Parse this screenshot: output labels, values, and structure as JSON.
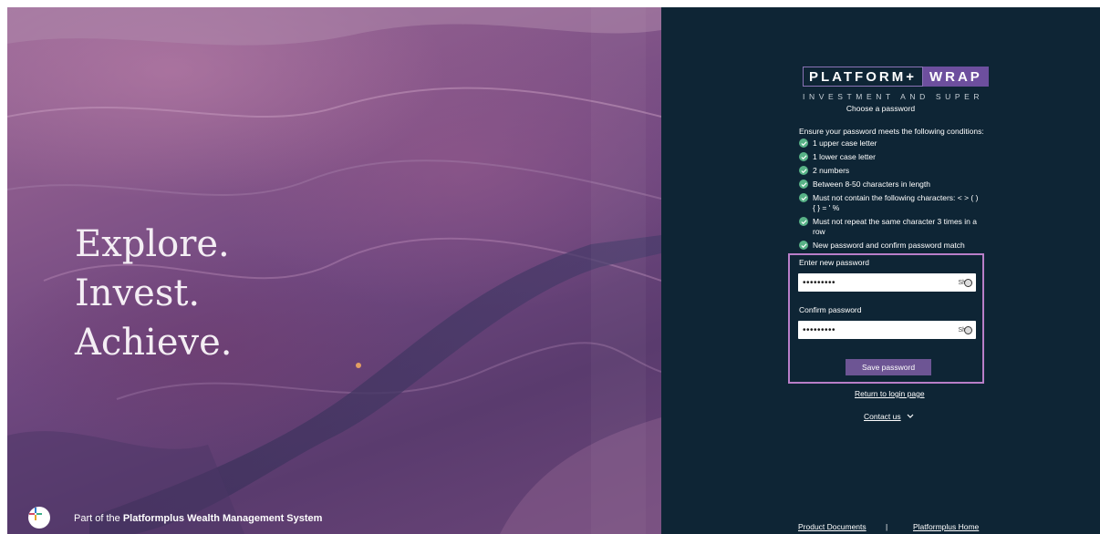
{
  "hero": {
    "lines": [
      "Explore.",
      "Invest.",
      "Achieve."
    ],
    "footer_prefix": "Part of the ",
    "footer_bold": "Platformplus Wealth Management System"
  },
  "logo": {
    "left": "PLATFORM+",
    "right": "WRAP",
    "subtitle": "INVESTMENT AND SUPER"
  },
  "form": {
    "heading": "Choose a password",
    "conditions_intro": "Ensure your password meets the following conditions:",
    "conditions": [
      "1 upper case letter",
      "1 lower case letter",
      "2 numbers",
      "Between 8-50 characters in length",
      "Must not contain the following characters: < > ( ) { } = ' %",
      "Must not repeat the same character 3 times in a row",
      "New password and confirm password match"
    ],
    "new_password_label": "Enter new password",
    "new_password_value": "•••••••••",
    "confirm_password_label": "Confirm password",
    "confirm_password_value": "•••••••••",
    "show_label": "Sh",
    "save_label": "Save password",
    "return_link": "Return to login page",
    "contact_label": "Contact us"
  },
  "footer": {
    "product_docs": "Product Documents",
    "separator": "|",
    "home": "Platformplus Home"
  },
  "colors": {
    "panel_bg": "#0e2535",
    "accent_purple": "#6d5594",
    "check_green": "#58b287",
    "highlight_border": "#b87ec8"
  }
}
